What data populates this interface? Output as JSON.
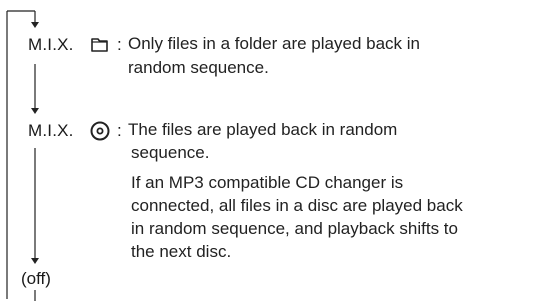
{
  "modes": [
    {
      "label": "M.I.X.",
      "icon": "folder-icon",
      "separator": ":",
      "description_lines": [
        "Only files in a folder are played back in",
        "random sequence."
      ]
    },
    {
      "label": "M.I.X.",
      "icon": "disc-icon",
      "separator": ":",
      "description_lines": [
        "The files are played back in random",
        "sequence.",
        "If an MP3 compatible CD changer is",
        "connected, all files in a disc are played back",
        "in random sequence, and playback shifts to",
        "the next disc."
      ]
    }
  ],
  "off_label": "(off)"
}
